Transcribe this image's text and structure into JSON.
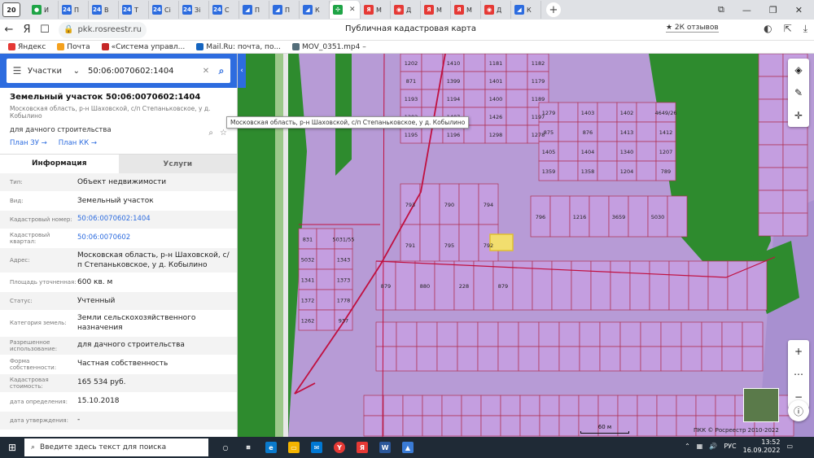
{
  "tabstrip": {
    "count": "20",
    "tabs": [
      {
        "label": "И",
        "color": "#1ea446",
        "glyph": "●"
      },
      {
        "label": "П",
        "color": "#2d6cdf",
        "glyph": "24"
      },
      {
        "label": "В",
        "color": "#2d6cdf",
        "glyph": "24"
      },
      {
        "label": "Т",
        "color": "#2d6cdf",
        "glyph": "24"
      },
      {
        "label": "Сі",
        "color": "#2d6cdf",
        "glyph": "24"
      },
      {
        "label": "Зі",
        "color": "#2d6cdf",
        "glyph": "24"
      },
      {
        "label": "С",
        "color": "#2d6cdf",
        "glyph": "24"
      },
      {
        "label": "П",
        "color": "#2d6cdf",
        "glyph": "◢"
      },
      {
        "label": "П",
        "color": "#2d6cdf",
        "glyph": "◢"
      },
      {
        "label": "К",
        "color": "#2d6cdf",
        "glyph": "◢"
      },
      {
        "label": "",
        "color": "#1ea446",
        "glyph": "✣",
        "active": true
      },
      {
        "label": "М",
        "color": "#e53935",
        "glyph": "Я"
      },
      {
        "label": "Д",
        "color": "#e53935",
        "glyph": "◉"
      },
      {
        "label": "М",
        "color": "#e53935",
        "glyph": "Я"
      },
      {
        "label": "М",
        "color": "#e53935",
        "glyph": "Я"
      },
      {
        "label": "Д",
        "color": "#e53935",
        "glyph": "◉"
      },
      {
        "label": "К",
        "color": "#2d6cdf",
        "glyph": "◢"
      }
    ]
  },
  "address": {
    "url": "pkk.rosreestr.ru",
    "title": "Публичная кадастровая карта",
    "reviews": "★ 2К отзывов"
  },
  "bookmarks": [
    {
      "label": "Яндекс",
      "color": "#e53935"
    },
    {
      "label": "Почта",
      "color": "#f4a11e"
    },
    {
      "label": "«Система управл...",
      "color": "#c62828"
    },
    {
      "label": "Mail.Ru: почта, по...",
      "color": "#1565c0"
    },
    {
      "label": "MOV_0351.mp4 –",
      "color": "#546e7a"
    }
  ],
  "search": {
    "type": "Участки",
    "query": "50:06:0070602:1404"
  },
  "object": {
    "title": "Земельный участок 50:06:0070602:1404",
    "address_short": "Московская область, р-н Шаховской, с/п Степаньковское, у д. Кобылино",
    "purpose": "для дачного строительства",
    "link_plan_zu": "План ЗУ",
    "link_plan_kk": "План КК"
  },
  "tabs": {
    "info": "Информация",
    "services": "Услуги"
  },
  "props": [
    {
      "k": "Тип:",
      "v": "Объект недвижимости"
    },
    {
      "k": "Вид:",
      "v": "Земельный участок"
    },
    {
      "k": "Кадастровый номер:",
      "v": "50:06:0070602:1404",
      "link": true
    },
    {
      "k": "Кадастровый квартал:",
      "v": "50:06:0070602",
      "link": true
    },
    {
      "k": "Адрес:",
      "v": "Московская область, р-н Шаховской, с/п Степаньковское, у д. Кобылино"
    },
    {
      "k": "Площадь уточненная:",
      "v": "600 кв. м"
    },
    {
      "k": "Статус:",
      "v": "Учтенный"
    },
    {
      "k": "Категория земель:",
      "v": "Земли сельскохозяйственного назначения"
    },
    {
      "k": "Разрешенное использование:",
      "v": "для дачного строительства"
    },
    {
      "k": "Форма собственности:",
      "v": "Частная собственность"
    },
    {
      "k": "Кадастровая стоимость:",
      "v": "165 534 руб."
    },
    {
      "k": "дата определения:",
      "v": "15.10.2018"
    },
    {
      "k": "дата утверждения:",
      "v": "-"
    }
  ],
  "tooltip": "Московская область, р-н Шаховской, с/п Степаньковское, у д. Кобылино",
  "map": {
    "parcel_fill": "#c49ee0",
    "green_fill": "#2e8b2e",
    "highlight_fill": "#f2de6e",
    "scale": "60 м",
    "copyright": "ПКК © Росреестр 2010-2022",
    "labels": [
      "1202",
      "1410",
      "1181",
      "1182",
      "871",
      "1399",
      "1401",
      "1179",
      "1193",
      "1194",
      "1400",
      "1189",
      "1202",
      "1407",
      "1426",
      "1197",
      "1195",
      "1196",
      "1298",
      "1278",
      "1279",
      "1403",
      "1402",
      "4649/26",
      "875",
      "876",
      "1413",
      "1412",
      "1405",
      "1404",
      "1340",
      "1207",
      "1359",
      "1358",
      "1204",
      "789",
      "793",
      "790",
      "794",
      "791",
      "795",
      "792",
      "796",
      "1216",
      "3659",
      "5030",
      "831",
      "5031/55",
      "5032",
      "1343",
      "1341",
      "1373",
      "1372",
      "1778",
      "1262",
      "937",
      "879",
      "880",
      "228",
      "879"
    ]
  },
  "taskbar": {
    "search_placeholder": "Введите здесь текст для поиска",
    "lang": "РУС",
    "time": "13:52",
    "date": "16.09.2022"
  }
}
